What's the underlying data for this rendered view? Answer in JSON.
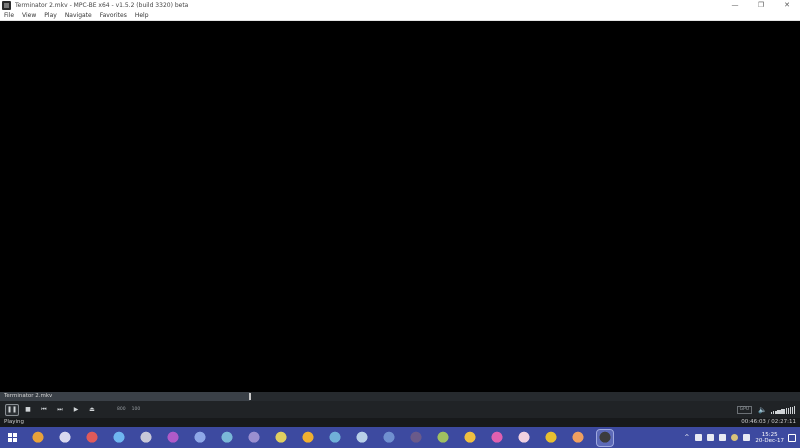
{
  "window": {
    "title": "Terminator 2.mkv - MPC-BE x64 - v1.5.2 (build 3320) beta",
    "controls": {
      "minimize": "—",
      "maximize": "❐",
      "close": "✕"
    }
  },
  "menu": {
    "items": [
      "File",
      "View",
      "Play",
      "Navigate",
      "Favorites",
      "Help"
    ]
  },
  "seekbar": {
    "filename": "Terminator 2.mkv",
    "progress": 0.312
  },
  "toolbar": {
    "pause": "❚❚",
    "stop": "■",
    "prev": "⏮",
    "next": "⏭",
    "frame_step": "▶",
    "eject": "⏏",
    "speed_a": "800",
    "speed_b": "100",
    "gpu_label": "GPU",
    "volume_icon": "🔈",
    "volume_level": 1.0
  },
  "status": {
    "state": "Playing",
    "time": "00:46:03 / 02:27:11"
  },
  "taskbar": {
    "apps": [
      {
        "name": "app-1",
        "color": "#e8a23a"
      },
      {
        "name": "app-2",
        "color": "#d9d9ef"
      },
      {
        "name": "app-3",
        "color": "#e05a5a"
      },
      {
        "name": "app-4",
        "color": "#6fb6f0"
      },
      {
        "name": "app-5",
        "color": "#c8c8d8"
      },
      {
        "name": "app-6",
        "color": "#b05ac8"
      },
      {
        "name": "app-7",
        "color": "#8fa8e8"
      },
      {
        "name": "app-8",
        "color": "#7ab8d8"
      },
      {
        "name": "app-9",
        "color": "#9a8fd0"
      },
      {
        "name": "app-10",
        "color": "#e0d060"
      },
      {
        "name": "app-11",
        "color": "#f0b030"
      },
      {
        "name": "app-12",
        "color": "#70b0d8"
      },
      {
        "name": "app-13",
        "color": "#b8d0e8"
      },
      {
        "name": "app-14",
        "color": "#7090d0"
      },
      {
        "name": "app-15",
        "color": "#6a5a8a"
      },
      {
        "name": "app-16",
        "color": "#a0c060"
      },
      {
        "name": "app-17",
        "color": "#f0c040"
      },
      {
        "name": "app-18",
        "color": "#e060b0"
      },
      {
        "name": "app-19",
        "color": "#f0d0e0"
      },
      {
        "name": "app-20",
        "color": "#e8c030"
      },
      {
        "name": "app-21",
        "color": "#f0a060"
      },
      {
        "name": "app-22",
        "color": "#3c3c3c",
        "active": true
      }
    ],
    "clock_time": "15:25",
    "clock_date": "20-Dec-17",
    "tray_arrow": "^"
  }
}
